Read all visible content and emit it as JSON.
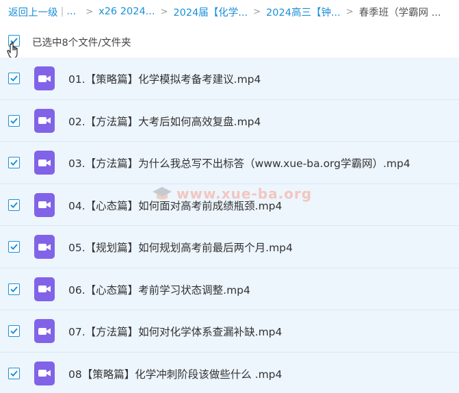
{
  "breadcrumb": {
    "back": "返回上一级",
    "ellipsis": "...",
    "items": [
      "x26 2024...",
      "2024届【化学...",
      "2024高三【钟..."
    ],
    "current": "春季班（学霸网 ..."
  },
  "selection": {
    "label": "已选中8个文件/文件夹",
    "checked": true
  },
  "files": [
    {
      "name": "01.【策略篇】化学模拟考备考建议.mp4",
      "icon": "video-icon",
      "checked": true
    },
    {
      "name": "02.【方法篇】大考后如何高效复盘.mp4",
      "icon": "video-icon",
      "checked": true
    },
    {
      "name": "03.【方法篇】为什么我总写不出标答（www.xue-ba.org学霸网）.mp4",
      "icon": "video-icon",
      "checked": true
    },
    {
      "name": "04.【心态篇】如何面对高考前成绩瓶颈.mp4",
      "icon": "video-icon",
      "checked": true
    },
    {
      "name": "05.【规划篇】如何规划高考前最后两个月.mp4",
      "icon": "video-icon",
      "checked": true
    },
    {
      "name": "06.【心态篇】考前学习状态调整.mp4",
      "icon": "video-icon",
      "checked": true
    },
    {
      "name": "07.【方法篇】如何对化学体系查漏补缺.mp4",
      "icon": "video-icon",
      "checked": true
    },
    {
      "name": "08【策略篇】化学冲刺阶段该做些什么 .mp4",
      "icon": "video-icon",
      "checked": true
    }
  ],
  "watermark": {
    "text": "www.xue-ba.org"
  },
  "colors": {
    "accent": "#1a8fd8",
    "row_bg": "#edf5fd",
    "video_icon": "#8163e8"
  }
}
